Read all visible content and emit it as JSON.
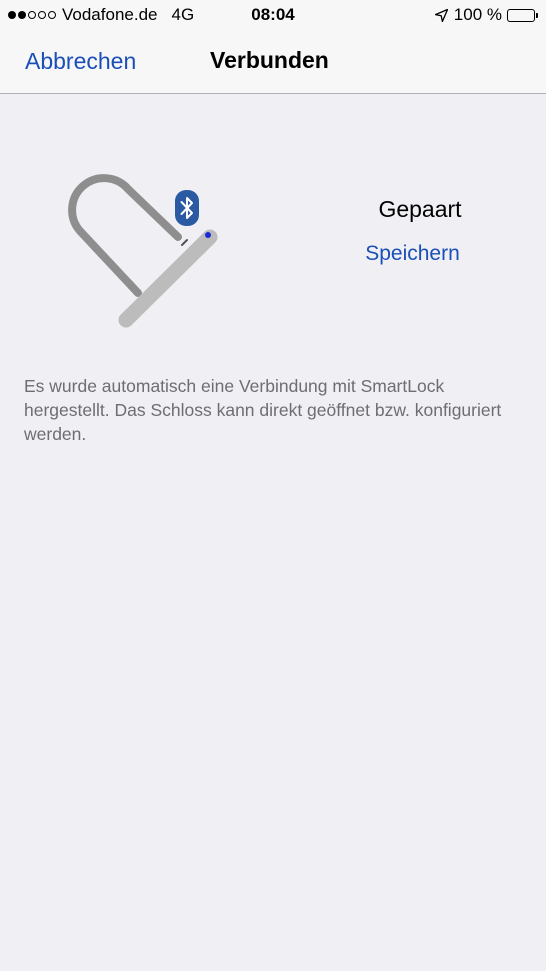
{
  "status_bar": {
    "carrier": "Vodafone.de",
    "network": "4G",
    "time": "08:04",
    "battery_percent": "100 %",
    "signal_bars_filled": 2,
    "signal_bars_total": 5,
    "battery_level": 1.0
  },
  "nav": {
    "cancel_label": "Abbrechen",
    "title": "Verbunden"
  },
  "device": {
    "status": "Gepaart",
    "save_label": "Speichern",
    "bluetooth_icon": "bluetooth-icon"
  },
  "description": "Es wurde automatisch eine Verbindung mit SmartLock hergestellt. Das Schloss kann direkt geöffnet bzw. konfiguriert werden.",
  "colors": {
    "accent": "#1b4fb8",
    "background": "#efeff4",
    "bar_background": "#f7f7f7",
    "secondary_text": "#6d6d72",
    "bluetooth_badge": "#2b5aa3",
    "lock_shackle": "#8e8e8e",
    "lock_body": "#bcbcbc"
  }
}
